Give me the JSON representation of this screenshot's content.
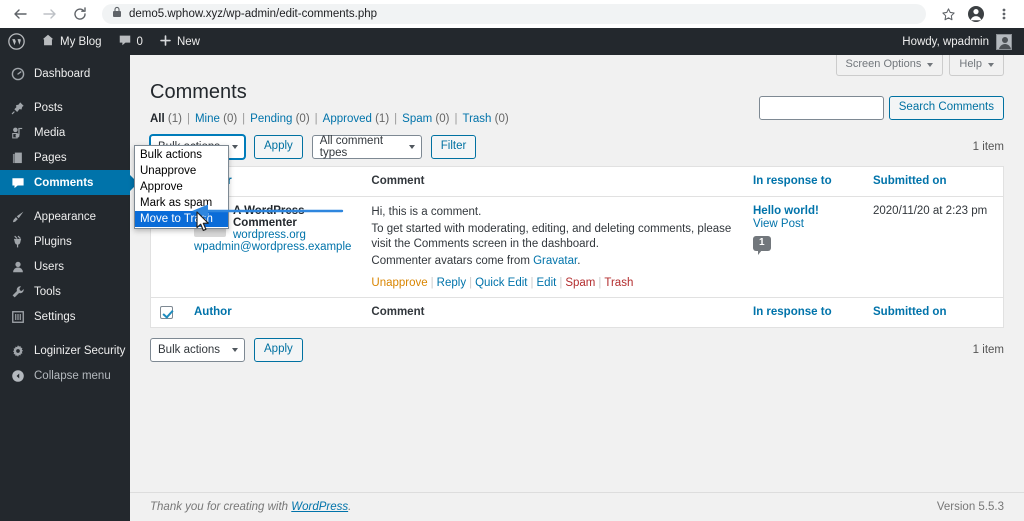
{
  "browser": {
    "url": "demo5.wphow.xyz/wp-admin/edit-comments.php",
    "back_icon": "back-arrow-icon",
    "forward_icon": "forward-arrow-icon",
    "reload_icon": "reload-icon",
    "lock_icon": "lock-icon",
    "star_icon": "star-icon",
    "profile_icon": "profile-icon",
    "menu_icon": "three-dot-menu-icon"
  },
  "adminbar": {
    "logo": "wordpress-logo-icon",
    "site_name": "My Blog",
    "comment_count": "0",
    "new_label": "New",
    "howdy": "Howdy, wpadmin"
  },
  "sidebar": {
    "items": [
      {
        "label": "Dashboard",
        "icon": "dashboard-icon",
        "current": false
      },
      {
        "label": "Posts",
        "icon": "pin-icon",
        "current": false
      },
      {
        "label": "Media",
        "icon": "media-icon",
        "current": false
      },
      {
        "label": "Pages",
        "icon": "pages-icon",
        "current": false
      },
      {
        "label": "Comments",
        "icon": "comment-bubble-icon",
        "current": true
      },
      {
        "label": "Appearance",
        "icon": "brush-icon",
        "current": false
      },
      {
        "label": "Plugins",
        "icon": "plug-icon",
        "current": false
      },
      {
        "label": "Users",
        "icon": "user-icon",
        "current": false
      },
      {
        "label": "Tools",
        "icon": "wrench-icon",
        "current": false
      },
      {
        "label": "Settings",
        "icon": "settings-icon",
        "current": false
      },
      {
        "label": "Loginizer Security",
        "icon": "gear-icon",
        "current": false
      },
      {
        "label": "Collapse menu",
        "icon": "collapse-icon",
        "current": false
      }
    ]
  },
  "screen_meta": {
    "screen_options": "Screen Options",
    "help": "Help"
  },
  "page": {
    "title": "Comments",
    "items_count_top": "1 item",
    "items_count_bottom": "1 item"
  },
  "filters": [
    {
      "label": "All",
      "count": "(1)",
      "current": true
    },
    {
      "label": "Mine",
      "count": "(0)",
      "current": false
    },
    {
      "label": "Pending",
      "count": "(0)",
      "current": false
    },
    {
      "label": "Approved",
      "count": "(1)",
      "current": false
    },
    {
      "label": "Spam",
      "count": "(0)",
      "current": false
    },
    {
      "label": "Trash",
      "count": "(0)",
      "current": false
    }
  ],
  "search": {
    "value": "",
    "placeholder": "",
    "button_label": "Search Comments"
  },
  "tablenav_top": {
    "bulk_select_value": "Bulk actions",
    "apply_label": "Apply",
    "comment_type_value": "All comment types",
    "filter_label": "Filter"
  },
  "tablenav_bottom": {
    "bulk_select_value": "Bulk actions",
    "apply_label": "Apply"
  },
  "bulk_dropdown": {
    "open": true,
    "options": [
      {
        "label": "Bulk actions",
        "selected": false
      },
      {
        "label": "Unapprove",
        "selected": false
      },
      {
        "label": "Approve",
        "selected": false
      },
      {
        "label": "Mark as spam",
        "selected": false
      },
      {
        "label": "Move to Trash",
        "selected": true
      }
    ],
    "highlight_color": "#0a6cd8"
  },
  "table": {
    "columns": {
      "author": "Author",
      "comment": "Comment",
      "response": "In response to",
      "date": "Submitted on"
    },
    "header_checkbox_checked": false,
    "footer_checkbox_checked": true,
    "rows": [
      {
        "checked": false,
        "author_name": "A WordPress Commenter",
        "author_site": "wordpress.org",
        "author_email": "wpadmin@wordpress.example",
        "comment_line1": "Hi, this is a comment.",
        "comment_line2": "To get started with moderating, editing, and deleting comments, please visit the Comments screen in the dashboard.",
        "comment_line3_pre": "Commenter avatars come from ",
        "comment_line3_link": "Gravatar",
        "comment_line3_post": ".",
        "actions": [
          {
            "label": "Unapprove",
            "kind": "unapprove"
          },
          {
            "label": "Reply",
            "kind": "normal"
          },
          {
            "label": "Quick Edit",
            "kind": "normal"
          },
          {
            "label": "Edit",
            "kind": "normal"
          },
          {
            "label": "Spam",
            "kind": "spam"
          },
          {
            "label": "Trash",
            "kind": "trash"
          }
        ],
        "response_title": "Hello world!",
        "view_post": "View Post",
        "response_count": "1",
        "date": "2020/11/20 at 2:23 pm"
      }
    ]
  },
  "footer": {
    "thanks_pre": "Thank you for creating with ",
    "thanks_link": "WordPress",
    "thanks_post": ".",
    "version": "Version 5.5.3"
  },
  "annotation": {
    "arrow_color": "#2e86de",
    "cursor": "mouse-pointer-icon"
  }
}
